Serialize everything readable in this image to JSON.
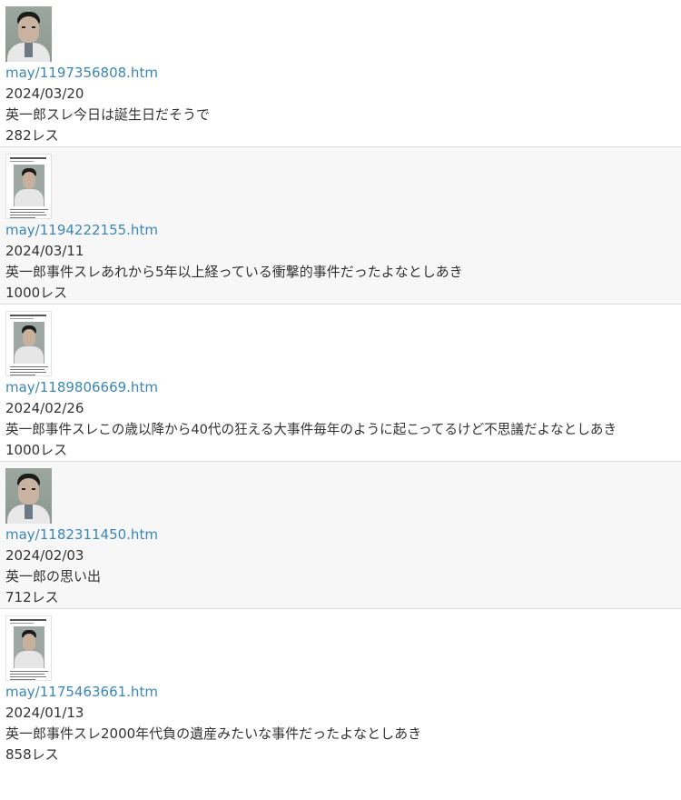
{
  "entries": [
    {
      "thumb_type": "face-photo",
      "link": "may/1197356808.htm",
      "date": "2024/03/20",
      "title": "英一郎スレ今日は誕生日だそうで",
      "replies": "282レス"
    },
    {
      "thumb_type": "document-screenshot",
      "link": "may/1194222155.htm",
      "date": "2024/03/11",
      "title": "英一郎事件スレあれから5年以上経っている衝撃的事件だったよなとしあき",
      "replies": "1000レス"
    },
    {
      "thumb_type": "document-screenshot",
      "link": "may/1189806669.htm",
      "date": "2024/02/26",
      "title": "英一郎事件スレこの歳以降から40代の狂える大事件毎年のように起こってるけど不思議だよなとしあき",
      "replies": "1000レス"
    },
    {
      "thumb_type": "face-photo",
      "link": "may/1182311450.htm",
      "date": "2024/02/03",
      "title": "英一郎の思い出",
      "replies": "712レス"
    },
    {
      "thumb_type": "document-screenshot",
      "link": "may/1175463661.htm",
      "date": "2024/01/13",
      "title": "英一郎事件スレ2000年代負の遺産みたいな事件だったよなとしあき",
      "replies": "858レス"
    }
  ],
  "colors": {
    "link": "#3a86b8",
    "text": "#333333",
    "alt_row_bg": "#f7f7f7",
    "divider": "#dcdcdc"
  }
}
